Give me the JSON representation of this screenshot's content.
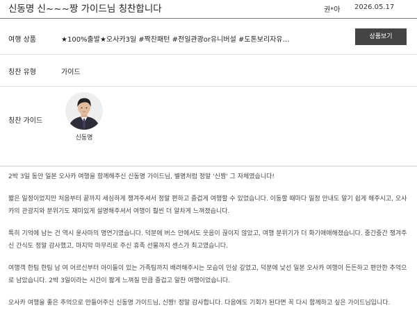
{
  "post": {
    "title": "신동명 신~~~짱 가이드님 칭찬합니다",
    "author": "권*아",
    "date": "2026.05.17"
  },
  "info": {
    "product_label": "여행 상품",
    "product_value": "★100%출발★오사카3일 #짝찬패턴 #전일관광or유니버설 #도톤보리자유식 #오...",
    "product_button": "상품보기",
    "type_label": "칭찬 유형",
    "type_value": "가이드",
    "guide_label": "칭찬 가이드",
    "guide_name": "신동명"
  },
  "review": {
    "paragraphs": [
      "2박 3일 동안 일본 오사카 여행을 함께해주신 신동명 가이드님, 별명처럼 정말 '신짱' 그 자체였습니다!",
      "짧은 일정이었지만 처음부터 끝까지 세심하게 챙겨주셔서 정말 편하고 즐겁게 여행할 수 있었습니다. 이동할 때마다 일정 안내도 알기 쉽게 해주시고, 오사카의 관광지와 분위기도 재미있게 설명해주셔서 여행이 훨씬 더 알차게 느껴졌습니다.",
      "특히 기억에 남는 건 역시 윤사마의 명연기였습니다. 덕분에 버스 안에서도 웃음이 끊이지 않았고, 여행 분위기가 더 화기애애해졌습니다. 중간중간 챙겨주신 간식도 정말 감사했고, 마지막 마무리로 주신 휴족 선물까지 센스가 최고였습니다.",
      "여행객 한팀 한팀 남 여 어르신부터 아이들이 있는 가족팀까지 배려해주시는 모습이 인상 깊었고, 덕분에 낯선 일본 오사카 여행이 든든하고 편안한 추억으로 남았습니다. 2박 3일이라는 시간이 짧게 느껴질 만큼 즐겁고 알찬 여행이었습니다.",
      "오사카 여행을 좋은 추억으로 만들어주신 신동명 가이드님, 신짱! 정말 감사합니다. 다음에도 기회가 된다면 꼭 다시 함께하고 싶은 가이드님입니다."
    ]
  },
  "colors": {
    "button_bg": "#444444",
    "divider": "#e2e2e2",
    "text": "#333333"
  }
}
